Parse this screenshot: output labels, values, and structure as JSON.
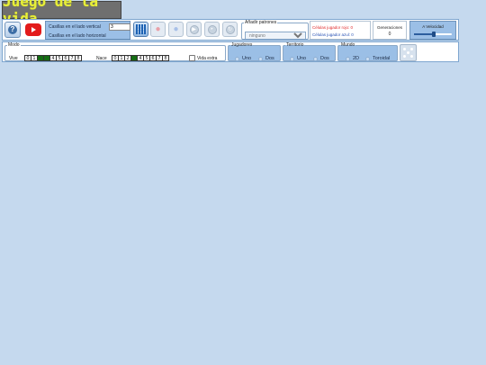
{
  "app": {
    "title": "Juego de la vida"
  },
  "toolbar": {
    "help_glyph": "?",
    "board": {
      "vertical_label": "Casillas en el lado vertical",
      "vertical_value": "3",
      "horizontal_label": "Casillas en el lado horizontal"
    },
    "tools": [
      {
        "icon": "grid-icon",
        "state": "active"
      },
      {
        "icon": "person-red-icon",
        "state": "disabled"
      },
      {
        "icon": "person-blue-icon",
        "state": "disabled"
      },
      {
        "icon": "play-icon",
        "state": "disabled"
      },
      {
        "icon": "step-icon",
        "state": "disabled"
      },
      {
        "icon": "reset-icon",
        "state": "disabled"
      }
    ],
    "patterns": {
      "legend": "Añadir patrones",
      "selected": "ninguno"
    },
    "cells": {
      "red_label": "Células jugador rojo: 0",
      "blue_label": "Células jugador azul: 0"
    },
    "generations": {
      "label": "Generaciones",
      "value": "0"
    },
    "speed": {
      "label": "A Velocidad",
      "level": 0.52
    }
  },
  "rules": {
    "legend": "Modo",
    "vive": {
      "label": "Vive",
      "cells": [
        "0",
        "1",
        "2",
        "3",
        "4",
        "5",
        "6",
        "7",
        "8"
      ],
      "on": [
        2,
        3
      ]
    },
    "nace": {
      "label": "Nace",
      "cells": [
        "0",
        "1",
        "2",
        "3",
        "4",
        "5",
        "6",
        "7",
        "8"
      ],
      "on": [
        3
      ]
    },
    "vida_extra_label": "Vida extra",
    "vida_extra_checked": false
  },
  "players": {
    "legend": "Jugadores",
    "options": [
      "Uno",
      "Dos"
    ]
  },
  "territory": {
    "legend": "Territorio",
    "options": [
      "Uno",
      "Dos"
    ]
  },
  "world": {
    "legend": "Mundo",
    "options": [
      "2D",
      "Toroidal"
    ]
  },
  "colors": {
    "background": "#c5d9ee",
    "accent": "#9bbfe6",
    "live_cell": "#156d14",
    "logo_text": "#e8ef3a"
  }
}
